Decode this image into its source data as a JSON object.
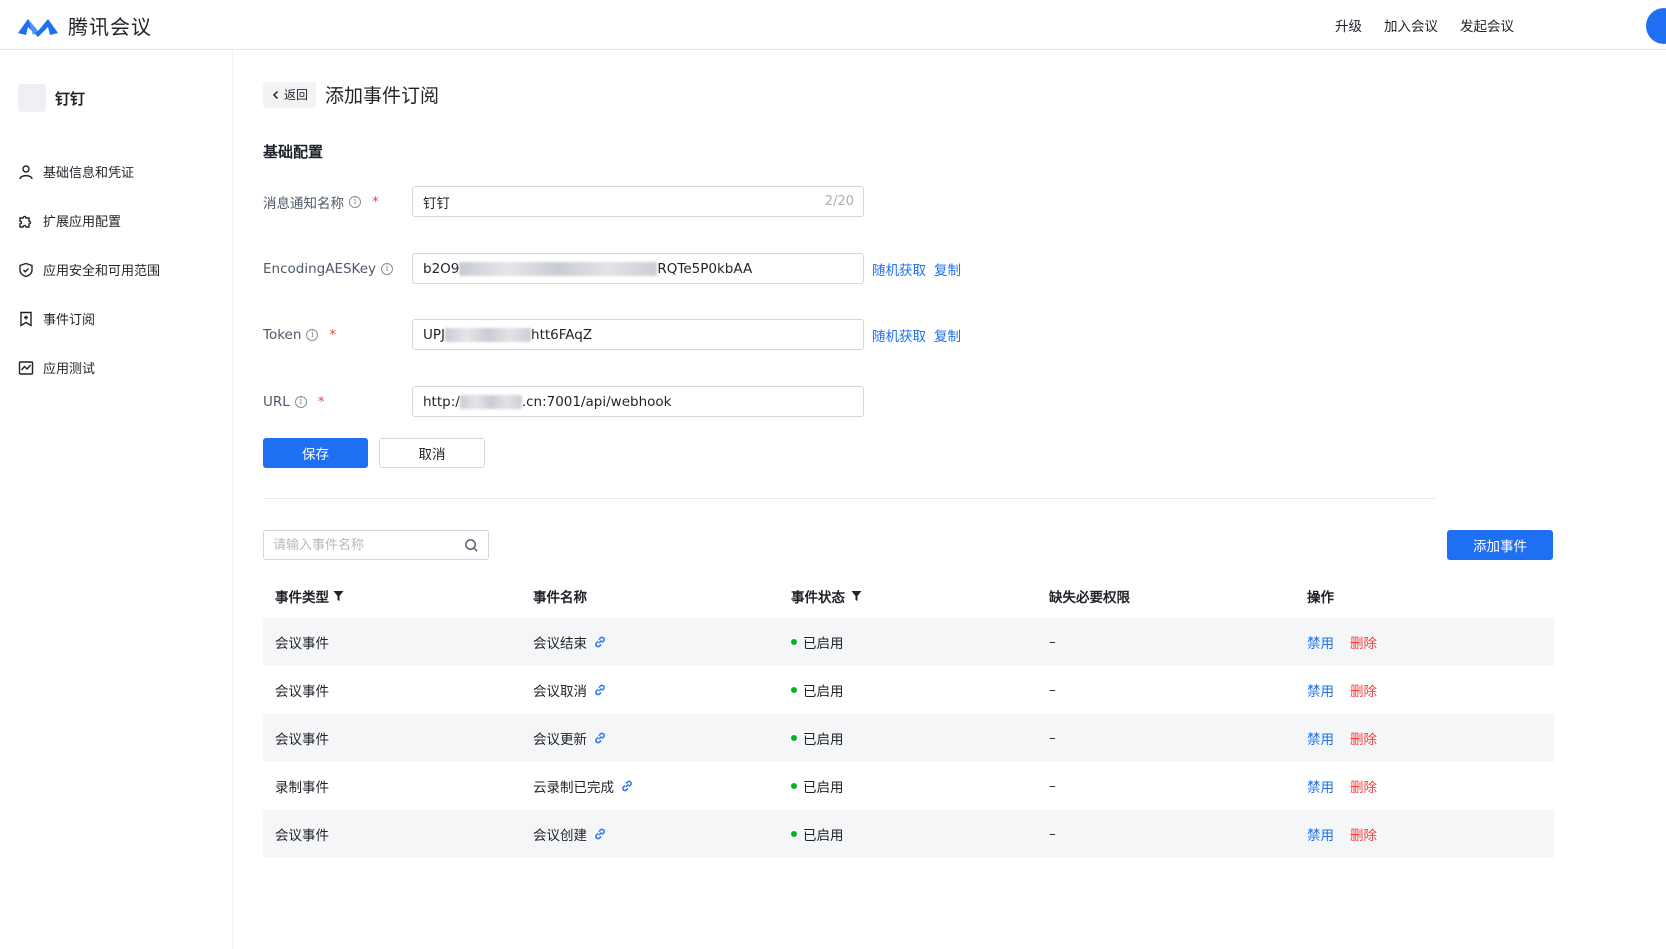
{
  "header": {
    "brand": "腾讯会议",
    "nav": [
      "升级",
      "加入会议",
      "发起会议"
    ],
    "colors": {
      "accent": "#1e6ff2",
      "danger": "#f53f3f",
      "success": "#00b42a"
    }
  },
  "sidebar": {
    "app_name": "钉钉",
    "items": [
      {
        "label": "基础信息和凭证",
        "icon": "user-icon"
      },
      {
        "label": "扩展应用配置",
        "icon": "puzzle-icon"
      },
      {
        "label": "应用安全和可用范围",
        "icon": "shield-icon"
      },
      {
        "label": "事件订阅",
        "icon": "bookmark-add-icon"
      },
      {
        "label": "应用测试",
        "icon": "chart-icon"
      }
    ]
  },
  "page": {
    "back_label": "返回",
    "title": "添加事件订阅",
    "section_title": "基础配置"
  },
  "form": {
    "name": {
      "label": "消息通知名称",
      "value": "钉钉",
      "counter": "2/20"
    },
    "aeskey": {
      "label": "EncodingAESKey",
      "value_prefix": "b2O9",
      "value_suffix": "RQTe5P0kbAA"
    },
    "token": {
      "label": "Token",
      "value_prefix": "UPJ",
      "value_suffix": "htt6FAqZ"
    },
    "url": {
      "label": "URL",
      "value_prefix": "http:/",
      "value_suffix": ".cn:7001/api/webhook"
    },
    "random_label": "随机获取",
    "copy_label": "复制",
    "save_label": "保存",
    "cancel_label": "取消"
  },
  "events": {
    "search_placeholder": "请输入事件名称",
    "add_label": "添加事件",
    "columns": [
      "事件类型",
      "事件名称",
      "事件状态",
      "缺失必要权限",
      "操作"
    ],
    "rows": [
      {
        "type": "会议事件",
        "name": "会议结束",
        "status": "已启用",
        "missing": "–"
      },
      {
        "type": "会议事件",
        "name": "会议取消",
        "status": "已启用",
        "missing": "–"
      },
      {
        "type": "会议事件",
        "name": "会议更新",
        "status": "已启用",
        "missing": "–"
      },
      {
        "type": "录制事件",
        "name": "云录制已完成",
        "status": "已启用",
        "missing": "–"
      },
      {
        "type": "会议事件",
        "name": "会议创建",
        "status": "已启用",
        "missing": "–"
      }
    ],
    "disable_label": "禁用",
    "delete_label": "删除"
  }
}
